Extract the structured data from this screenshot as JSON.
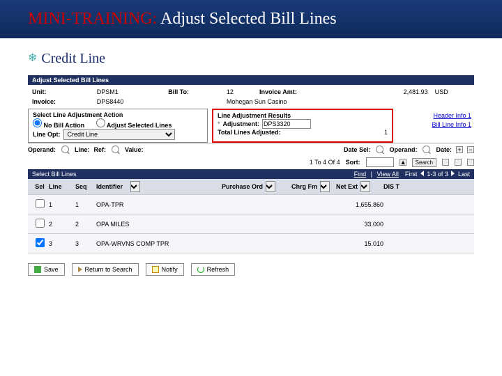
{
  "slide": {
    "prefix": "MINI-TRAINING:",
    "suffix": "Adjust Selected Bill Lines",
    "subheading": "Credit Line"
  },
  "page": {
    "title": "Adjust Selected Bill Lines"
  },
  "header": {
    "unit_lbl": "Unit:",
    "unit_val": "DPSM1",
    "billto_lbl": "Bill To:",
    "billto_val": "12",
    "invamt_lbl": "Invoice Amt:",
    "invamt_val": "2,481.93",
    "invamt_cur": "USD",
    "invoice_lbl": "Invoice:",
    "invoice_val": "DPS8440",
    "billto_name": "Mohegan Sun Casino"
  },
  "actionPanel": {
    "title": "Select Line Adjustment Action",
    "opt_none": "No Bill Action",
    "opt_adjust": "Adjust Selected Lines",
    "lineopt_lbl": "Line Opt:",
    "lineopt_val": "Credit Line"
  },
  "resultsPanel": {
    "title": "Line Adjustment Results",
    "adj_lbl": "Adjustment:",
    "adj_val": "DPS3320",
    "total_lbl": "Total Lines Adjusted:",
    "total_val": "1"
  },
  "links": {
    "hdr": "Header Info 1",
    "line": "Bill Line Info 1"
  },
  "criteria": {
    "operand_lbl": "Operand:",
    "line_lbl": "Line:",
    "ref_lbl": "Ref:",
    "value_lbl": "Value:",
    "datesel_lbl": "Date Sel:",
    "operand2_lbl": "Operand:",
    "date_lbl": "Date:"
  },
  "pager": {
    "range": "1 To 4 Of 4",
    "sort_lbl": "Sort:",
    "search_lbl": "Search"
  },
  "grid": {
    "title": "Select Bill Lines",
    "find": "Find",
    "view": "View All",
    "nav": "First",
    "range": "1-3 of 3",
    "last": "Last",
    "cols": {
      "sel": "Sel",
      "line": "Line",
      "seq": "Seq",
      "id": "Identifier",
      "po": "Purchase Ord",
      "chrg": "Chrg Fm",
      "net": "Net Ext",
      "dist": "DIS T"
    },
    "rows": [
      {
        "sel": false,
        "line": "1",
        "seq": "1",
        "id": "OPA-TPR",
        "net": "1,655.860"
      },
      {
        "sel": false,
        "line": "2",
        "seq": "2",
        "id": "OPA MILES",
        "net": "33.000"
      },
      {
        "sel": true,
        "line": "3",
        "seq": "3",
        "id": "OPA-WRVNS COMP TPR",
        "net": "15.010"
      }
    ]
  },
  "footer": {
    "save": "Save",
    "back": "Return to Search",
    "notify": "Notify",
    "refresh": "Refresh"
  }
}
